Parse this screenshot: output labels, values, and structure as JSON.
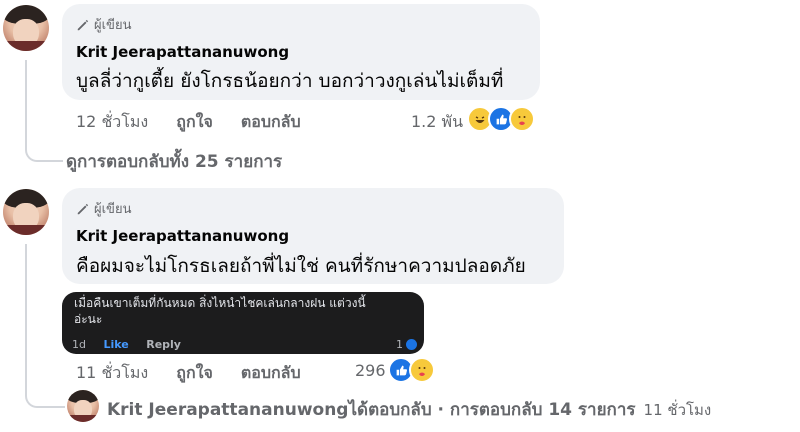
{
  "comments": [
    {
      "badge": "ผู้เขียน",
      "author": "Krit Jeerapattananuwong",
      "text": "บูลลี่ว่ากูเตี้ย ยังโกรธน้อยกว่า บอกว่าวงกูเล่นไม่เต็มที่",
      "time": "12 ชั่วโมง",
      "like": "ถูกใจ",
      "reply": "ตอบกลับ",
      "reaction_count": "1.2 พัน",
      "reactions": [
        "haha-icon",
        "like-icon",
        "care-icon"
      ]
    },
    {
      "badge": "ผู้เขียน",
      "author": "Krit Jeerapattananuwong",
      "text": "คือผมจะไม่โกรธเลยถ้าพี่ไม่ใช่ คนที่รักษาความปลอดภัย",
      "time": "11 ชั่วโมง",
      "like": "ถูกใจ",
      "reply": "ตอบกลับ",
      "reaction_count": "296",
      "reactions": [
        "like-icon",
        "care-icon"
      ]
    }
  ],
  "view_replies": "ดูการตอบกลับทั้ง 25 รายการ",
  "attachment": {
    "line1": "เมื่อคืนเขาเต็มที่กันหมด สิ่งไหนำไชคเล่นกลางฝน แต่วงนี้",
    "line2": "อ่ะนะ",
    "time": "1d",
    "like": "Like",
    "reply": "Reply",
    "count": "1"
  },
  "reply_summary": {
    "name": "Krit Jeerapattananuwong",
    "action": " ได้ตอบกลับ · การตอบกลับ 14 รายการ",
    "time": "11 ชั่วโมง"
  }
}
